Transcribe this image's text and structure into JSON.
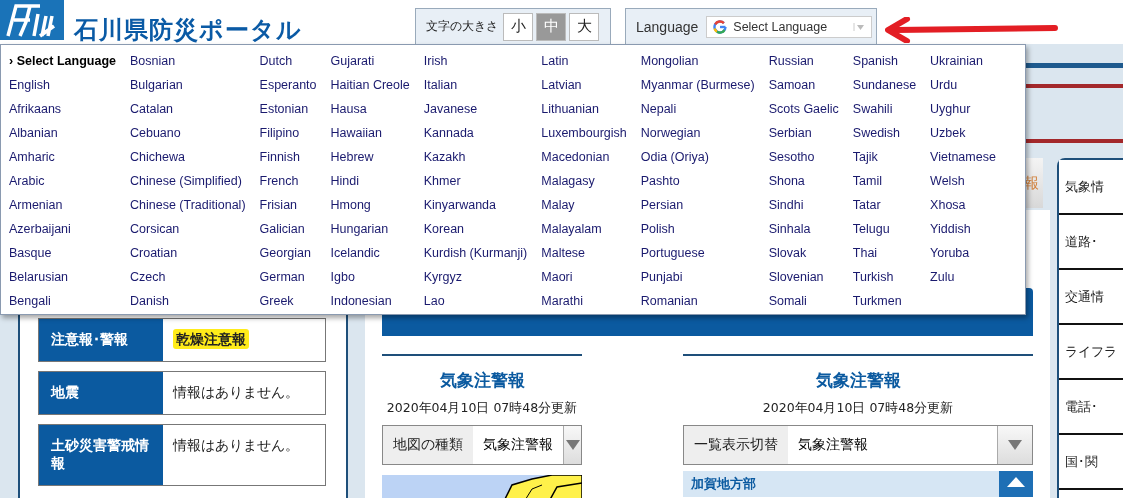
{
  "header": {
    "site_title": "石川県防災ポータル",
    "font_size": {
      "label": "文字の大きさ",
      "options": [
        {
          "label": "小",
          "selected": false
        },
        {
          "label": "中",
          "selected": true
        },
        {
          "label": "大",
          "selected": false
        }
      ]
    },
    "language": {
      "label": "Language",
      "select": "Select Language"
    }
  },
  "language_menu": {
    "items": [
      {
        "label": "› Select Language",
        "selected": true
      },
      {
        "label": "English",
        "selected": false
      },
      {
        "label": "Afrikaans",
        "selected": false
      },
      {
        "label": "Albanian",
        "selected": false
      },
      {
        "label": "Amharic",
        "selected": false
      },
      {
        "label": "Arabic",
        "selected": false
      },
      {
        "label": "Armenian",
        "selected": false
      },
      {
        "label": "Azerbaijani",
        "selected": false
      },
      {
        "label": "Basque",
        "selected": false
      },
      {
        "label": "Belarusian",
        "selected": false
      },
      {
        "label": "Bengali",
        "selected": false
      },
      {
        "label": "Bosnian",
        "selected": false
      },
      {
        "label": "Bulgarian",
        "selected": false
      },
      {
        "label": "Catalan",
        "selected": false
      },
      {
        "label": "Cebuano",
        "selected": false
      },
      {
        "label": "Chichewa",
        "selected": false
      },
      {
        "label": "Chinese (Simplified)",
        "selected": false
      },
      {
        "label": "Chinese (Traditional)",
        "selected": false
      },
      {
        "label": "Corsican",
        "selected": false
      },
      {
        "label": "Croatian",
        "selected": false
      },
      {
        "label": "Czech",
        "selected": false
      },
      {
        "label": "Danish",
        "selected": false
      },
      {
        "label": "Dutch",
        "selected": false
      },
      {
        "label": "Esperanto",
        "selected": false
      },
      {
        "label": "Estonian",
        "selected": false
      },
      {
        "label": "Filipino",
        "selected": false
      },
      {
        "label": "Finnish",
        "selected": false
      },
      {
        "label": "French",
        "selected": false
      },
      {
        "label": "Frisian",
        "selected": false
      },
      {
        "label": "Galician",
        "selected": false
      },
      {
        "label": "Georgian",
        "selected": false
      },
      {
        "label": "German",
        "selected": false
      },
      {
        "label": "Greek",
        "selected": false
      },
      {
        "label": "Gujarati",
        "selected": false
      },
      {
        "label": "Haitian Creole",
        "selected": false
      },
      {
        "label": "Hausa",
        "selected": false
      },
      {
        "label": "Hawaiian",
        "selected": false
      },
      {
        "label": "Hebrew",
        "selected": false
      },
      {
        "label": "Hindi",
        "selected": false
      },
      {
        "label": "Hmong",
        "selected": false
      },
      {
        "label": "Hungarian",
        "selected": false
      },
      {
        "label": "Icelandic",
        "selected": false
      },
      {
        "label": "Igbo",
        "selected": false
      },
      {
        "label": "Indonesian",
        "selected": false
      },
      {
        "label": "Irish",
        "selected": false
      },
      {
        "label": "Italian",
        "selected": false
      },
      {
        "label": "Javanese",
        "selected": false
      },
      {
        "label": "Kannada",
        "selected": false
      },
      {
        "label": "Kazakh",
        "selected": false
      },
      {
        "label": "Khmer",
        "selected": false
      },
      {
        "label": "Kinyarwanda",
        "selected": false
      },
      {
        "label": "Korean",
        "selected": false
      },
      {
        "label": "Kurdish (Kurmanji)",
        "selected": false
      },
      {
        "label": "Kyrgyz",
        "selected": false
      },
      {
        "label": "Lao",
        "selected": false
      },
      {
        "label": "Latin",
        "selected": false
      },
      {
        "label": "Latvian",
        "selected": false
      },
      {
        "label": "Lithuanian",
        "selected": false
      },
      {
        "label": "Luxembourgish",
        "selected": false
      },
      {
        "label": "Macedonian",
        "selected": false
      },
      {
        "label": "Malagasy",
        "selected": false
      },
      {
        "label": "Malay",
        "selected": false
      },
      {
        "label": "Malayalam",
        "selected": false
      },
      {
        "label": "Maltese",
        "selected": false
      },
      {
        "label": "Maori",
        "selected": false
      },
      {
        "label": "Marathi",
        "selected": false
      },
      {
        "label": "Mongolian",
        "selected": false
      },
      {
        "label": "Myanmar (Burmese)",
        "selected": false
      },
      {
        "label": "Nepali",
        "selected": false
      },
      {
        "label": "Norwegian",
        "selected": false
      },
      {
        "label": "Odia (Oriya)",
        "selected": false
      },
      {
        "label": "Pashto",
        "selected": false
      },
      {
        "label": "Persian",
        "selected": false
      },
      {
        "label": "Polish",
        "selected": false
      },
      {
        "label": "Portuguese",
        "selected": false
      },
      {
        "label": "Punjabi",
        "selected": false
      },
      {
        "label": "Romanian",
        "selected": false
      },
      {
        "label": "Russian",
        "selected": false
      },
      {
        "label": "Samoan",
        "selected": false
      },
      {
        "label": "Scots Gaelic",
        "selected": false
      },
      {
        "label": "Serbian",
        "selected": false
      },
      {
        "label": "Sesotho",
        "selected": false
      },
      {
        "label": "Shona",
        "selected": false
      },
      {
        "label": "Sindhi",
        "selected": false
      },
      {
        "label": "Sinhala",
        "selected": false
      },
      {
        "label": "Slovak",
        "selected": false
      },
      {
        "label": "Slovenian",
        "selected": false
      },
      {
        "label": "Somali",
        "selected": false
      },
      {
        "label": "Spanish",
        "selected": false
      },
      {
        "label": "Sundanese",
        "selected": false
      },
      {
        "label": "Swahili",
        "selected": false
      },
      {
        "label": "Swedish",
        "selected": false
      },
      {
        "label": "Tajik",
        "selected": false
      },
      {
        "label": "Tamil",
        "selected": false
      },
      {
        "label": "Tatar",
        "selected": false
      },
      {
        "label": "Telugu",
        "selected": false
      },
      {
        "label": "Thai",
        "selected": false
      },
      {
        "label": "Turkish",
        "selected": false
      },
      {
        "label": "Turkmen",
        "selected": false
      },
      {
        "label": "Ukrainian",
        "selected": false
      },
      {
        "label": "Urdu",
        "selected": false
      },
      {
        "label": "Uyghur",
        "selected": false
      },
      {
        "label": "Uzbek",
        "selected": false
      },
      {
        "label": "Vietnamese",
        "selected": false
      },
      {
        "label": "Welsh",
        "selected": false
      },
      {
        "label": "Xhosa",
        "selected": false
      },
      {
        "label": "Yiddish",
        "selected": false
      },
      {
        "label": "Yoruba",
        "selected": false
      },
      {
        "label": "Zulu",
        "selected": false
      }
    ]
  },
  "alerts": [
    {
      "label": "注意報･警報",
      "value": "乾燥注意報",
      "kind": "badge"
    },
    {
      "label": "地震",
      "value": "情報はありません。",
      "kind": "text"
    },
    {
      "label": "土砂災害警戒情報",
      "value": "情報はありません。",
      "kind": "text"
    }
  ],
  "center": {
    "tab": "報",
    "panels": [
      {
        "title": "気象注警報",
        "updated": "2020年04月10日 07時48分更新",
        "selector": {
          "label": "地図の種類",
          "value": "気象注警報"
        },
        "kind": "map"
      },
      {
        "title": "気象注警報",
        "updated": "2020年04月10日 07時48分更新",
        "selector": {
          "label": "一覧表示切替",
          "value": "気象注警報"
        },
        "kind": "list",
        "section": "加賀地方部"
      }
    ]
  },
  "side_nav": [
    "気象情",
    "道路･",
    "交通情",
    "ライフラ",
    "電話･",
    "国･関"
  ]
}
